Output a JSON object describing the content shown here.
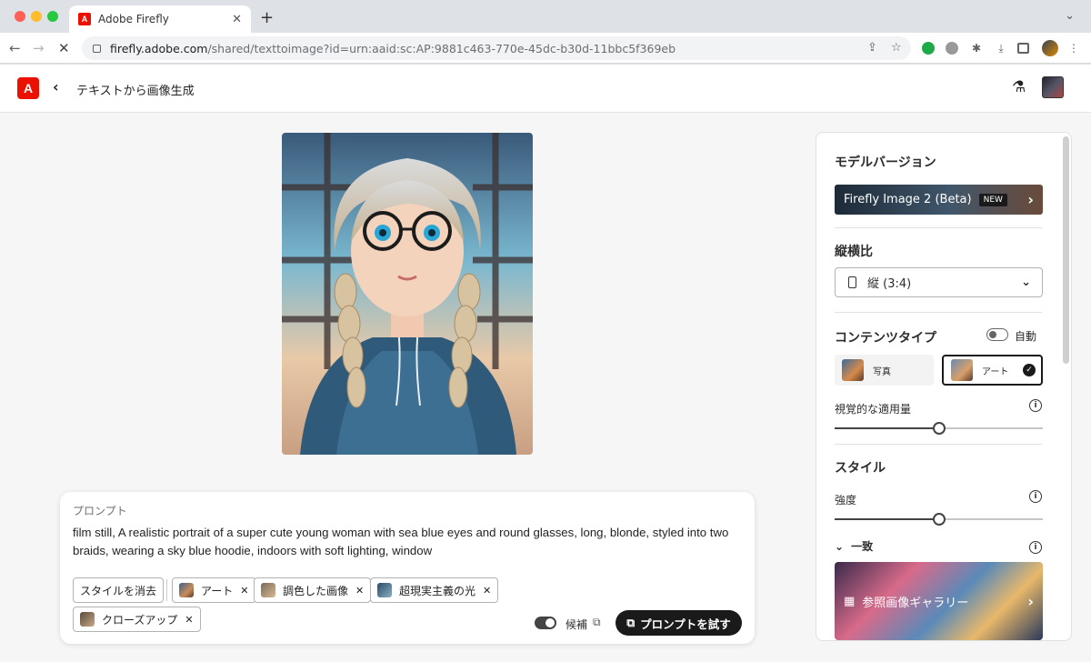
{
  "browser": {
    "tab_title": "Adobe Firefly",
    "url_host": "firefly.adobe.com",
    "url_path": "/shared/texttoimage?id=urn:aaid:sc:AP:9881c463-770e-45dc-b30d-11bbc5f369eb"
  },
  "app": {
    "logo_letter": "A",
    "title": "テキストから画像生成"
  },
  "prompt": {
    "label": "プロンプト",
    "text": "film still, A realistic portrait of a super cute young woman with sea blue eyes and round glasses, long, blonde, styled into two braids, wearing a sky blue hoodie, indoors with soft lighting, window",
    "clear_styles": "スタイルを消去",
    "chips": [
      "アート",
      "調色した画像",
      "超現実主義の光",
      "クローズアップ"
    ],
    "suggest_label": "候補",
    "try_button": "プロンプトを試す"
  },
  "panel": {
    "model_heading": "モデルバージョン",
    "model_name": "Firefly Image 2 (Beta)",
    "model_badge": "NEW",
    "aspect_heading": "縦横比",
    "aspect_value": "縦 (3:4)",
    "content_heading": "コンテンツタイプ",
    "auto_label": "自動",
    "content_options": [
      "写真",
      "アート"
    ],
    "visual_intensity_label": "視覚的な適用量",
    "visual_intensity_value": 0.5,
    "style_heading": "スタイル",
    "strength_label": "強度",
    "strength_value": 0.5,
    "match_label": "一致",
    "gallery_label": "参照画像ギャラリー"
  },
  "colors": {
    "adobe_red": "#eb1000",
    "dark": "#1a1a1a"
  }
}
